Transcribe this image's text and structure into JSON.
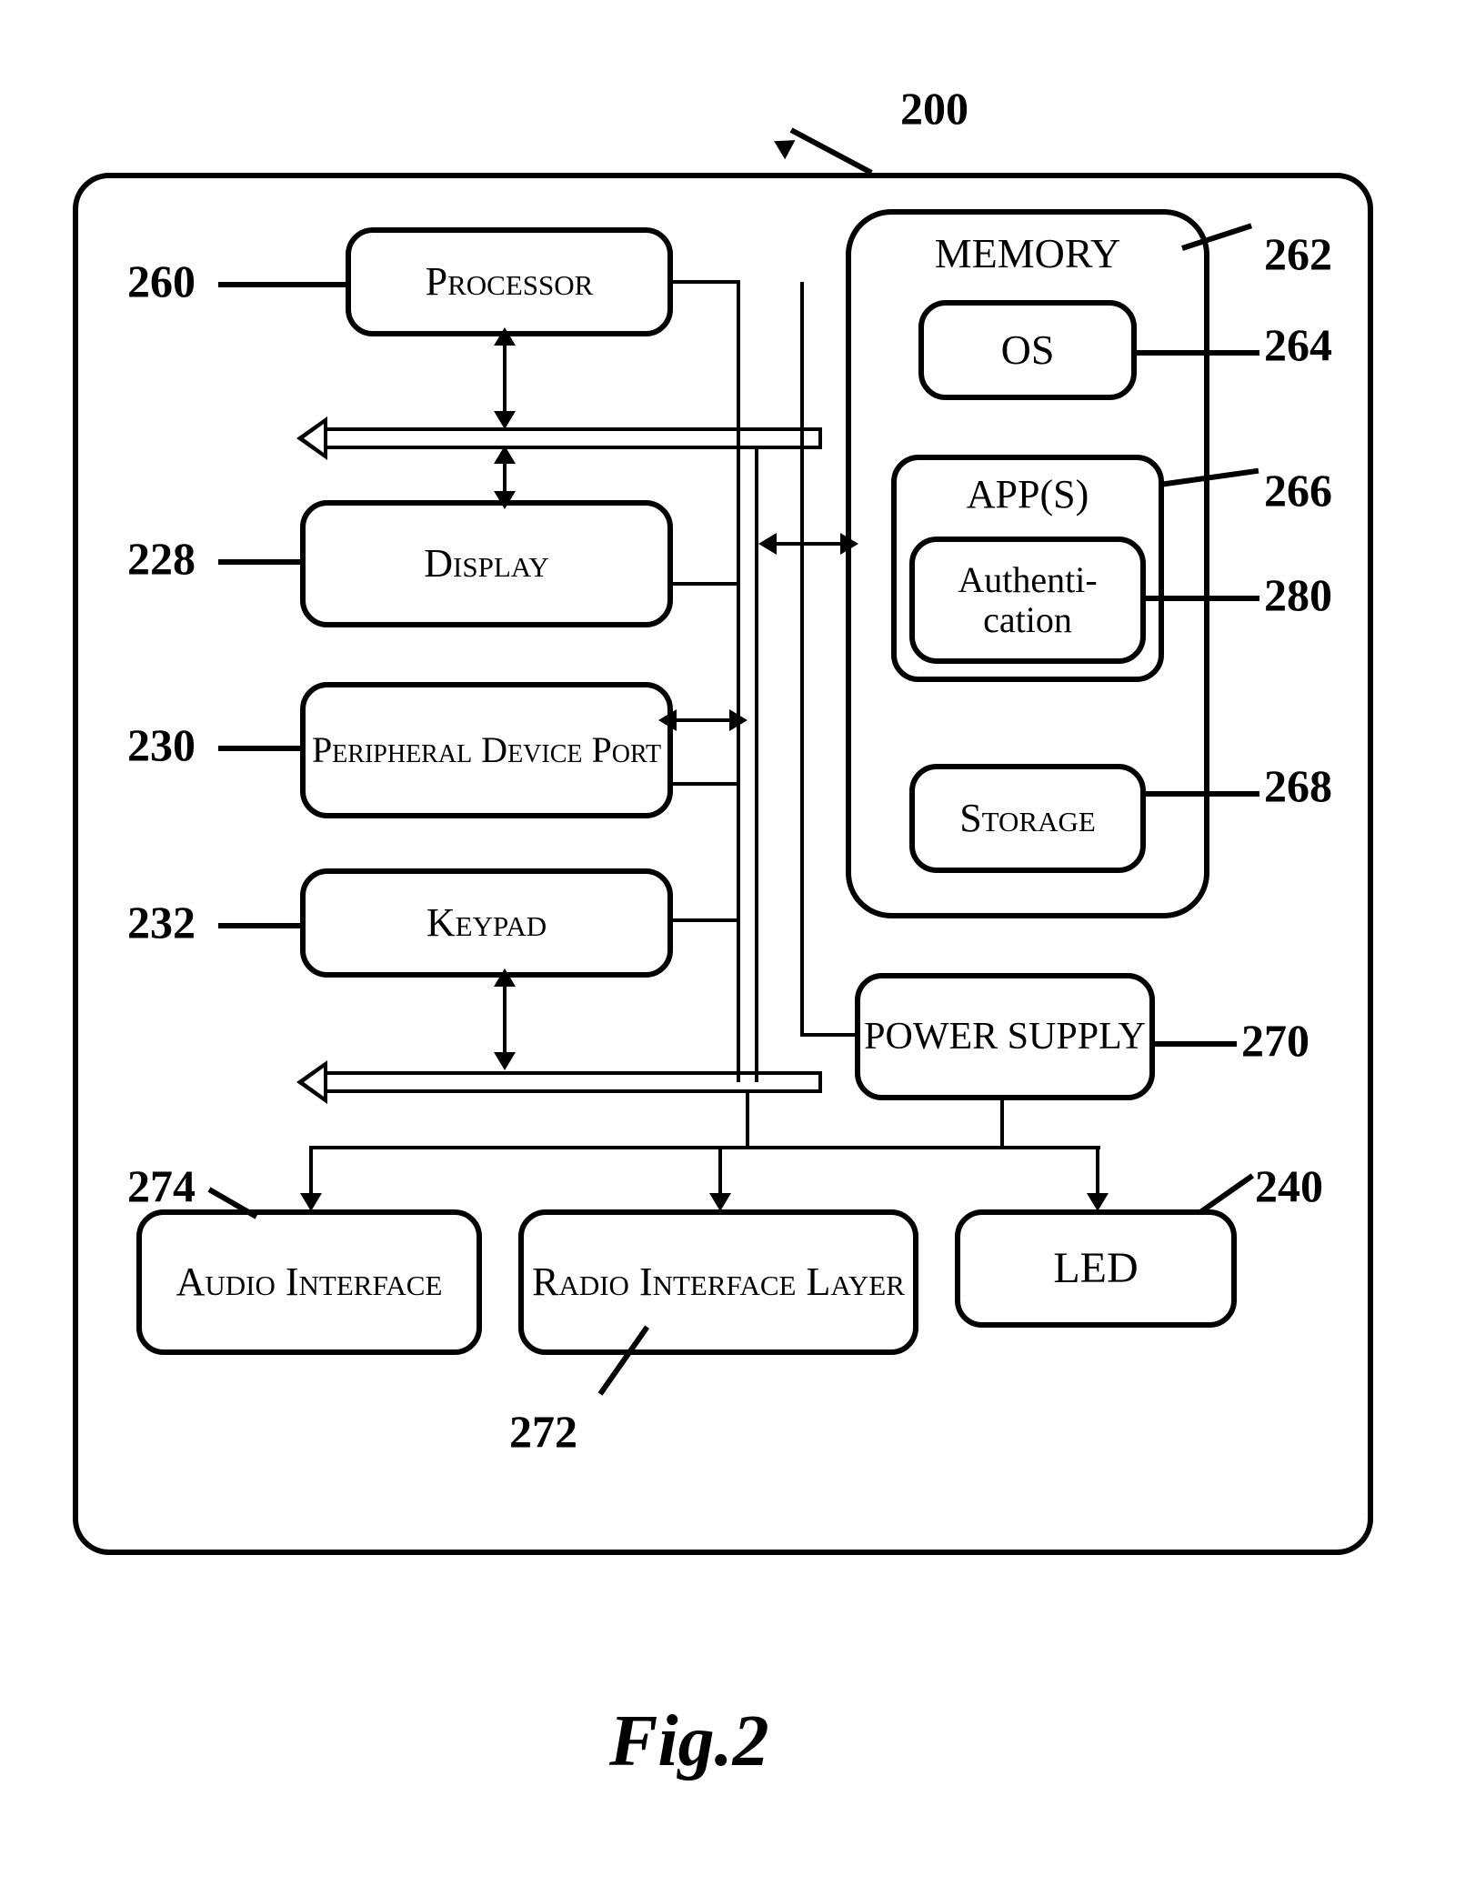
{
  "figure": {
    "caption": "Fig.2",
    "system_ref": "200"
  },
  "blocks": {
    "processor": {
      "label": "Processor",
      "ref": "260"
    },
    "display": {
      "label": "Display",
      "ref": "228"
    },
    "peripheral": {
      "label": "Peripheral Device Port",
      "ref": "230"
    },
    "keypad": {
      "label": "Keypad",
      "ref": "232"
    },
    "memory": {
      "label": "MEMORY",
      "ref": "262"
    },
    "os": {
      "label": "OS",
      "ref": "264"
    },
    "apps": {
      "label": "APP(S)",
      "ref": "266"
    },
    "auth": {
      "label": "Authenti-\ncation",
      "ref": "280"
    },
    "storage": {
      "label": "Storage",
      "ref": "268"
    },
    "power": {
      "label": "POWER SUPPLY",
      "ref": "270"
    },
    "audio": {
      "label": "Audio Interface",
      "ref": "274"
    },
    "radio": {
      "label": "Radio Interface Layer",
      "ref": "272"
    },
    "led": {
      "label": "LED",
      "ref": "240"
    }
  }
}
